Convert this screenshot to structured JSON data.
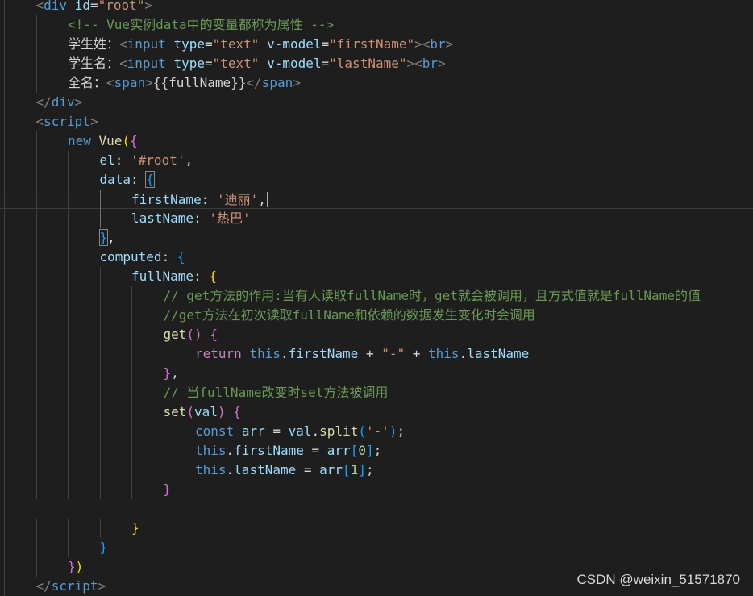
{
  "editor": {
    "colors": {
      "background": "#1e1e1e",
      "tag": "#569cd6",
      "attribute": "#9cdcfe",
      "string": "#ce9178",
      "comment": "#6a9955",
      "function": "#dcdcaa",
      "number": "#b5cea8",
      "bracket_level_1": "#ffd700",
      "bracket_level_2": "#da70d6",
      "bracket_level_3": "#179fff"
    },
    "current_line": 10,
    "lines": [
      {
        "indent": 1,
        "guides": [
          0
        ],
        "tokens": [
          [
            "<",
            "punct"
          ],
          [
            "div",
            "tag"
          ],
          [
            " ",
            "text"
          ],
          [
            "id",
            "attr"
          ],
          [
            "=",
            "text"
          ],
          [
            "\"root\"",
            "str"
          ],
          [
            ">",
            "punct"
          ]
        ]
      },
      {
        "indent": 2,
        "guides": [
          0,
          1
        ],
        "tokens": [
          [
            "<!-- Vue实例data中的变量都称为属性 -->",
            "comment"
          ]
        ]
      },
      {
        "indent": 2,
        "guides": [
          0,
          1
        ],
        "tokens": [
          [
            "学生姓：",
            "text"
          ],
          [
            "<",
            "punct"
          ],
          [
            "input",
            "tag"
          ],
          [
            " ",
            "text"
          ],
          [
            "type",
            "attr"
          ],
          [
            "=",
            "text"
          ],
          [
            "\"text\"",
            "str"
          ],
          [
            " ",
            "text"
          ],
          [
            "v-model",
            "attr"
          ],
          [
            "=",
            "text"
          ],
          [
            "\"firstName\"",
            "str"
          ],
          [
            ">",
            "punct"
          ],
          [
            "<",
            "punct"
          ],
          [
            "br",
            "tag"
          ],
          [
            ">",
            "punct"
          ]
        ]
      },
      {
        "indent": 2,
        "guides": [
          0,
          1
        ],
        "tokens": [
          [
            "学生名：",
            "text"
          ],
          [
            "<",
            "punct"
          ],
          [
            "input",
            "tag"
          ],
          [
            " ",
            "text"
          ],
          [
            "type",
            "attr"
          ],
          [
            "=",
            "text"
          ],
          [
            "\"text\"",
            "str"
          ],
          [
            " ",
            "text"
          ],
          [
            "v-model",
            "attr"
          ],
          [
            "=",
            "text"
          ],
          [
            "\"lastName\"",
            "str"
          ],
          [
            ">",
            "punct"
          ],
          [
            "<",
            "punct"
          ],
          [
            "br",
            "tag"
          ],
          [
            ">",
            "punct"
          ]
        ]
      },
      {
        "indent": 2,
        "guides": [
          0,
          1
        ],
        "tokens": [
          [
            "全名：",
            "text"
          ],
          [
            "<",
            "punct"
          ],
          [
            "span",
            "tag"
          ],
          [
            ">",
            "punct"
          ],
          [
            "{{fullName}}",
            "text"
          ],
          [
            "</",
            "punct"
          ],
          [
            "span",
            "tag"
          ],
          [
            ">",
            "punct"
          ]
        ]
      },
      {
        "indent": 1,
        "guides": [
          0
        ],
        "tokens": [
          [
            "</",
            "punct"
          ],
          [
            "div",
            "tag"
          ],
          [
            ">",
            "punct"
          ]
        ]
      },
      {
        "indent": 1,
        "guides": [
          0
        ],
        "tokens": [
          [
            "<",
            "punct"
          ],
          [
            "script",
            "tag"
          ],
          [
            ">",
            "punct"
          ]
        ]
      },
      {
        "indent": 2,
        "guides": [
          0,
          1
        ],
        "tokens": [
          [
            "new",
            "kw"
          ],
          [
            " ",
            "text"
          ],
          [
            "Vue",
            "fn"
          ],
          [
            "(",
            "b1"
          ],
          [
            "{",
            "b2"
          ]
        ]
      },
      {
        "indent": 3,
        "guides": [
          0,
          1,
          2
        ],
        "tokens": [
          [
            "el",
            "prop"
          ],
          [
            ": ",
            "text"
          ],
          [
            "'#root'",
            "str"
          ],
          [
            ",",
            "text"
          ]
        ]
      },
      {
        "indent": 3,
        "guides": [
          0,
          1,
          2
        ],
        "tokens": [
          [
            "data",
            "prop"
          ],
          [
            ": ",
            "text"
          ],
          [
            "{",
            "b3 bracket-box"
          ]
        ]
      },
      {
        "indent": 4,
        "guides": [
          0,
          1,
          2,
          3
        ],
        "active_guide": 3,
        "cursor_after": true,
        "tokens": [
          [
            "firstName",
            "prop"
          ],
          [
            ": ",
            "text"
          ],
          [
            "'迪丽'",
            "str"
          ],
          [
            ",",
            "text"
          ]
        ]
      },
      {
        "indent": 4,
        "guides": [
          0,
          1,
          2,
          3
        ],
        "active_guide": 3,
        "tokens": [
          [
            "lastName",
            "prop"
          ],
          [
            ": ",
            "text"
          ],
          [
            "'热巴'",
            "str"
          ]
        ]
      },
      {
        "indent": 3,
        "guides": [
          0,
          1,
          2
        ],
        "tokens": [
          [
            "}",
            "b3 bracket-box"
          ],
          [
            ",",
            "text"
          ]
        ]
      },
      {
        "indent": 3,
        "guides": [
          0,
          1,
          2
        ],
        "tokens": [
          [
            "computed",
            "prop"
          ],
          [
            ": ",
            "text"
          ],
          [
            "{",
            "b3"
          ]
        ]
      },
      {
        "indent": 4,
        "guides": [
          0,
          1,
          2,
          3
        ],
        "tokens": [
          [
            "fullName",
            "prop"
          ],
          [
            ": ",
            "text"
          ],
          [
            "{",
            "b1"
          ]
        ]
      },
      {
        "indent": 5,
        "guides": [
          0,
          1,
          2,
          3,
          4
        ],
        "tokens": [
          [
            "// get方法的作用:当有人读取fullName时，get就会被调用，且方式值就是fullName的值",
            "comment"
          ]
        ]
      },
      {
        "indent": 5,
        "guides": [
          0,
          1,
          2,
          3,
          4
        ],
        "tokens": [
          [
            "//get方法在初次读取fullName和依赖的数据发生变化时会调用",
            "comment"
          ]
        ]
      },
      {
        "indent": 5,
        "guides": [
          0,
          1,
          2,
          3,
          4
        ],
        "tokens": [
          [
            "get",
            "fn"
          ],
          [
            "(",
            "b2"
          ],
          [
            ")",
            "b2"
          ],
          [
            " ",
            "text"
          ],
          [
            "{",
            "b2"
          ]
        ]
      },
      {
        "indent": 6,
        "guides": [
          0,
          1,
          2,
          3,
          4,
          5
        ],
        "tokens": [
          [
            "return",
            "ctl"
          ],
          [
            " ",
            "text"
          ],
          [
            "this",
            "kw"
          ],
          [
            ".",
            "text"
          ],
          [
            "firstName",
            "prop"
          ],
          [
            " + ",
            "op"
          ],
          [
            "\"-\"",
            "str"
          ],
          [
            " + ",
            "op"
          ],
          [
            "this",
            "kw"
          ],
          [
            ".",
            "text"
          ],
          [
            "lastName",
            "prop"
          ]
        ]
      },
      {
        "indent": 5,
        "guides": [
          0,
          1,
          2,
          3,
          4
        ],
        "tokens": [
          [
            "}",
            "b2"
          ],
          [
            ",",
            "text"
          ]
        ]
      },
      {
        "indent": 5,
        "guides": [
          0,
          1,
          2,
          3,
          4
        ],
        "tokens": [
          [
            "// 当fullName改变时set方法被调用",
            "comment"
          ]
        ]
      },
      {
        "indent": 5,
        "guides": [
          0,
          1,
          2,
          3,
          4
        ],
        "tokens": [
          [
            "set",
            "fn"
          ],
          [
            "(",
            "b2"
          ],
          [
            "val",
            "prop"
          ],
          [
            ")",
            "b2"
          ],
          [
            " ",
            "text"
          ],
          [
            "{",
            "b2"
          ]
        ]
      },
      {
        "indent": 6,
        "guides": [
          0,
          1,
          2,
          3,
          4,
          5
        ],
        "tokens": [
          [
            "const",
            "kw"
          ],
          [
            " ",
            "text"
          ],
          [
            "arr",
            "prop"
          ],
          [
            " = ",
            "op"
          ],
          [
            "val",
            "prop"
          ],
          [
            ".",
            "text"
          ],
          [
            "split",
            "fn"
          ],
          [
            "(",
            "b3"
          ],
          [
            "'-'",
            "str"
          ],
          [
            ")",
            "b3"
          ],
          [
            ";",
            "text"
          ]
        ]
      },
      {
        "indent": 6,
        "guides": [
          0,
          1,
          2,
          3,
          4,
          5
        ],
        "tokens": [
          [
            "this",
            "kw"
          ],
          [
            ".",
            "text"
          ],
          [
            "firstName",
            "prop"
          ],
          [
            " = ",
            "op"
          ],
          [
            "arr",
            "prop"
          ],
          [
            "[",
            "b3"
          ],
          [
            "0",
            "num"
          ],
          [
            "]",
            "b3"
          ],
          [
            ";",
            "text"
          ]
        ]
      },
      {
        "indent": 6,
        "guides": [
          0,
          1,
          2,
          3,
          4,
          5
        ],
        "tokens": [
          [
            "this",
            "kw"
          ],
          [
            ".",
            "text"
          ],
          [
            "lastName",
            "prop"
          ],
          [
            " = ",
            "op"
          ],
          [
            "arr",
            "prop"
          ],
          [
            "[",
            "b3"
          ],
          [
            "1",
            "num"
          ],
          [
            "]",
            "b3"
          ],
          [
            ";",
            "text"
          ]
        ]
      },
      {
        "indent": 5,
        "guides": [
          0,
          1,
          2,
          3,
          4
        ],
        "tokens": [
          [
            "}",
            "b2"
          ]
        ]
      },
      {
        "indent": 0,
        "guides": [
          0
        ],
        "tokens": []
      },
      {
        "indent": 4,
        "guides": [
          0,
          1,
          2,
          3
        ],
        "tokens": [
          [
            "}",
            "b1"
          ]
        ]
      },
      {
        "indent": 3,
        "guides": [
          0,
          1,
          2
        ],
        "tokens": [
          [
            "}",
            "b3"
          ]
        ]
      },
      {
        "indent": 2,
        "guides": [
          0,
          1
        ],
        "tokens": [
          [
            "}",
            "b2"
          ],
          [
            ")",
            "b1"
          ]
        ]
      },
      {
        "indent": 1,
        "guides": [
          0
        ],
        "tokens": [
          [
            "</",
            "punct"
          ],
          [
            "script",
            "tag"
          ],
          [
            ">",
            "punct"
          ]
        ]
      }
    ]
  },
  "watermark": "CSDN @weixin_51571870"
}
